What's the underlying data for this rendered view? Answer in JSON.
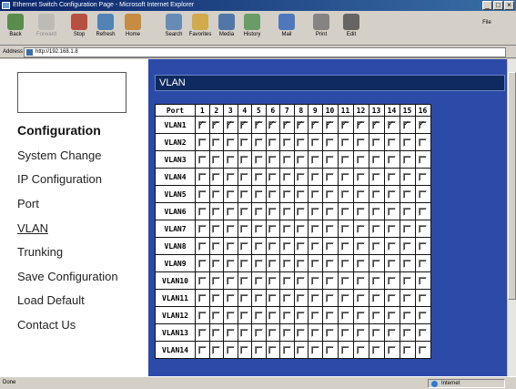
{
  "browser": {
    "title": "Ethernet Switch Configuration Page - Microsoft Internet Explorer",
    "toolbar": [
      {
        "label": "Back",
        "icon": "back-arrow-icon",
        "disabled": false
      },
      {
        "label": "Forward",
        "icon": "forward-arrow-icon",
        "disabled": true
      },
      {
        "label": "Stop",
        "icon": "stop-icon",
        "disabled": false
      },
      {
        "label": "Refresh",
        "icon": "refresh-icon",
        "disabled": false
      },
      {
        "label": "Home",
        "icon": "home-icon",
        "disabled": false
      },
      {
        "label": "Search",
        "icon": "search-icon",
        "disabled": false
      },
      {
        "label": "Favorites",
        "icon": "favorites-icon",
        "disabled": false
      },
      {
        "label": "Media",
        "icon": "media-icon",
        "disabled": false
      },
      {
        "label": "History",
        "icon": "history-icon",
        "disabled": false
      },
      {
        "label": "Mail",
        "icon": "mail-icon",
        "disabled": false
      },
      {
        "label": "Print",
        "icon": "print-icon",
        "disabled": false
      },
      {
        "label": "Edit",
        "icon": "edit-icon",
        "disabled": false
      }
    ],
    "address_label": "Address",
    "address_value": "http://192.168.1.8",
    "file_menu": "File",
    "status_text": "Done",
    "zone_text": "Internet"
  },
  "sidebar": {
    "heading": "Configuration",
    "items": [
      {
        "label": "System Change",
        "active": false
      },
      {
        "label": "IP Configuration",
        "active": false
      },
      {
        "label": "Port",
        "active": false
      },
      {
        "label": "VLAN",
        "active": true
      },
      {
        "label": "Trunking",
        "active": false
      },
      {
        "label": "Save Configuration",
        "active": false
      },
      {
        "label": "Load Default",
        "active": false
      },
      {
        "label": "Contact Us",
        "active": false
      }
    ]
  },
  "main": {
    "title": "VLAN",
    "port_header": "Port",
    "ports": [
      "1",
      "2",
      "3",
      "4",
      "5",
      "6",
      "7",
      "8",
      "9",
      "10",
      "11",
      "12",
      "13",
      "14",
      "15",
      "16"
    ],
    "vlans": [
      {
        "label": "VLAN1",
        "checked": [
          true,
          true,
          true,
          true,
          true,
          true,
          true,
          true,
          true,
          true,
          true,
          true,
          true,
          true,
          true,
          true
        ]
      },
      {
        "label": "VLAN2",
        "checked": [
          false,
          false,
          false,
          false,
          false,
          false,
          false,
          false,
          false,
          false,
          false,
          false,
          false,
          false,
          false,
          false
        ]
      },
      {
        "label": "VLAN3",
        "checked": [
          false,
          false,
          false,
          false,
          false,
          false,
          false,
          false,
          false,
          false,
          false,
          false,
          false,
          false,
          false,
          false
        ]
      },
      {
        "label": "VLAN4",
        "checked": [
          false,
          false,
          false,
          false,
          false,
          false,
          false,
          false,
          false,
          false,
          false,
          false,
          false,
          false,
          false,
          false
        ]
      },
      {
        "label": "VLAN5",
        "checked": [
          false,
          false,
          false,
          false,
          false,
          false,
          false,
          false,
          false,
          false,
          false,
          false,
          false,
          false,
          false,
          false
        ]
      },
      {
        "label": "VLAN6",
        "checked": [
          false,
          false,
          false,
          false,
          false,
          false,
          false,
          false,
          false,
          false,
          false,
          false,
          false,
          false,
          false,
          false
        ]
      },
      {
        "label": "VLAN7",
        "checked": [
          false,
          false,
          false,
          false,
          false,
          false,
          false,
          false,
          false,
          false,
          false,
          false,
          false,
          false,
          false,
          false
        ]
      },
      {
        "label": "VLAN8",
        "checked": [
          false,
          false,
          false,
          false,
          false,
          false,
          false,
          false,
          false,
          false,
          false,
          false,
          false,
          false,
          false,
          false
        ]
      },
      {
        "label": "VLAN9",
        "checked": [
          false,
          false,
          false,
          false,
          false,
          false,
          false,
          false,
          false,
          false,
          false,
          false,
          false,
          false,
          false,
          false
        ]
      },
      {
        "label": "VLAN10",
        "checked": [
          false,
          false,
          false,
          false,
          false,
          false,
          false,
          false,
          false,
          false,
          false,
          false,
          false,
          false,
          false,
          false
        ]
      },
      {
        "label": "VLAN11",
        "checked": [
          false,
          false,
          false,
          false,
          false,
          false,
          false,
          false,
          false,
          false,
          false,
          false,
          false,
          false,
          false,
          false
        ]
      },
      {
        "label": "VLAN12",
        "checked": [
          false,
          false,
          false,
          false,
          false,
          false,
          false,
          false,
          false,
          false,
          false,
          false,
          false,
          false,
          false,
          false
        ]
      },
      {
        "label": "VLAN13",
        "checked": [
          false,
          false,
          false,
          false,
          false,
          false,
          false,
          false,
          false,
          false,
          false,
          false,
          false,
          false,
          false,
          false
        ]
      },
      {
        "label": "VLAN14",
        "checked": [
          false,
          false,
          false,
          false,
          false,
          false,
          false,
          false,
          false,
          false,
          false,
          false,
          false,
          false,
          false,
          false
        ]
      }
    ]
  },
  "colors": {
    "panel_bg": "#2c4aa8",
    "title_bar": "#0e2a5e",
    "browser_chrome": "#d4d0c8"
  }
}
